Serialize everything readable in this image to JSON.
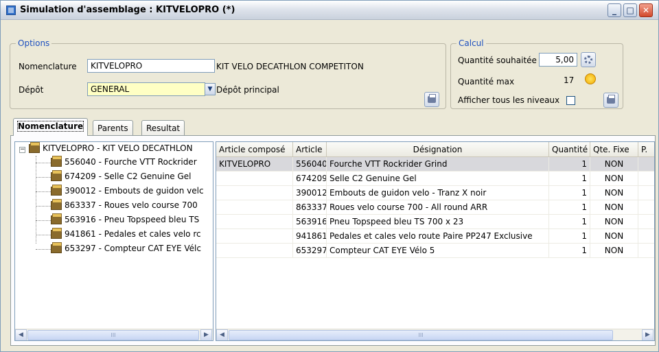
{
  "window": {
    "title": "Simulation d'assemblage : KITVELOPRO (*)"
  },
  "options": {
    "legend": "Options",
    "nomenclature_label": "Nomenclature",
    "nomenclature_value": "KITVELOPRO",
    "nomenclature_desc": "KIT VELO DECATHLON COMPETITON",
    "depot_label": "Dépôt",
    "depot_value": "GENERAL",
    "depot_desc": "Dépôt principal"
  },
  "calcul": {
    "legend": "Calcul",
    "qte_souhaitee_label": "Quantité souhaitée",
    "qte_souhaitee_value": "5,00",
    "qte_max_label": "Quantité max",
    "qte_max_value": "17",
    "afficher_label": "Afficher tous les niveaux"
  },
  "tabs": [
    {
      "label": "Nomenclature",
      "active": true
    },
    {
      "label": "Parents",
      "active": false
    },
    {
      "label": "Resultat",
      "active": false
    }
  ],
  "tree": {
    "root": "KITVELOPRO - KIT VELO DECATHLON",
    "children": [
      "556040 - Fourche VTT Rockrider",
      "674209 - Selle C2 Genuine Gel",
      "390012 - Embouts de guidon velc",
      "863337 - Roues velo course 700",
      "563916 - Pneu Topspeed bleu TS",
      "941861 - Pedales et cales velo rc",
      "653297 - Compteur CAT EYE Vélc"
    ]
  },
  "grid": {
    "columns": [
      "Article composé",
      "Article",
      "Désignation",
      "Quantité",
      "Qte. Fixe",
      "P."
    ],
    "rows": [
      {
        "compose": "KITVELOPRO",
        "article": "556040",
        "designation": "Fourche VTT Rockrider Grind",
        "quantite": "1",
        "fixe": "NON"
      },
      {
        "compose": "",
        "article": "674209",
        "designation": "Selle C2 Genuine Gel",
        "quantite": "1",
        "fixe": "NON"
      },
      {
        "compose": "",
        "article": "390012",
        "designation": "Embouts de guidon velo  - Tranz X noir",
        "quantite": "1",
        "fixe": "NON"
      },
      {
        "compose": "",
        "article": "863337",
        "designation": "Roues velo course 700  - All round ARR",
        "quantite": "1",
        "fixe": "NON"
      },
      {
        "compose": "",
        "article": "563916",
        "designation": "Pneu Topspeed bleu TS 700 x 23",
        "quantite": "1",
        "fixe": "NON"
      },
      {
        "compose": "",
        "article": "941861",
        "designation": "Pedales et cales velo route Paire PP247 Exclusive",
        "quantite": "1",
        "fixe": "NON"
      },
      {
        "compose": "",
        "article": "653297",
        "designation": "Compteur CAT EYE Vélo 5",
        "quantite": "1",
        "fixe": "NON"
      }
    ]
  },
  "scrollbar": {
    "thumb_grip": "III"
  },
  "colors": {
    "accent": "#1c4fbf",
    "selected_row": "#d8d8dc",
    "depot_field": "#ffffc4"
  }
}
